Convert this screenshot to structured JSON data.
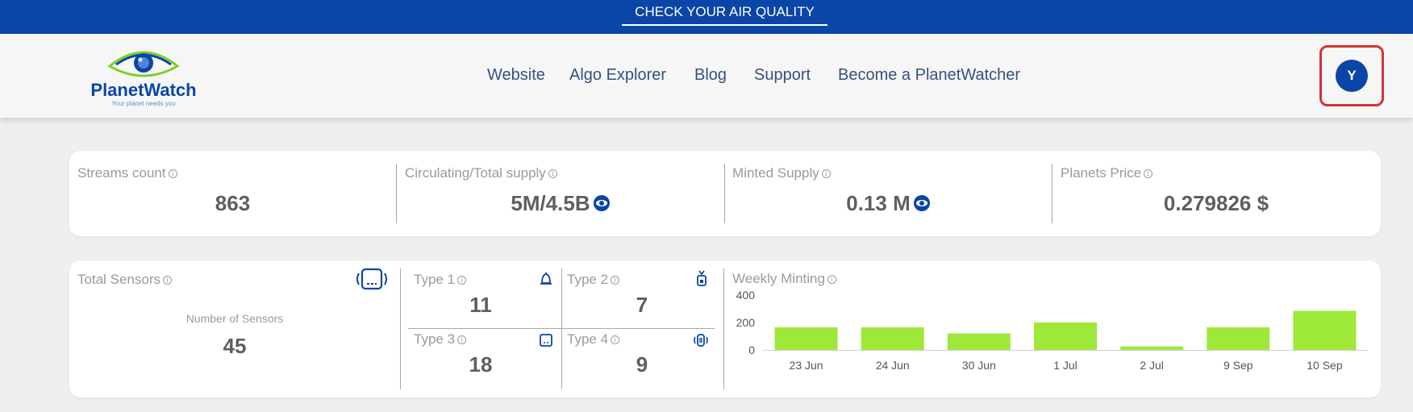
{
  "topbar": {
    "cta": "CHECK YOUR AIR QUALITY"
  },
  "logo": {
    "brand": "PlanetWatch",
    "tagline": "Your planet needs you"
  },
  "nav": [
    "Website",
    "Algo Explorer",
    "Blog",
    "Support",
    "Become a PlanetWatcher"
  ],
  "user": {
    "initial": "Y"
  },
  "stats": [
    {
      "label": "Streams count",
      "value": "863"
    },
    {
      "label": "Circulating/Total supply",
      "value": "5M/4.5B"
    },
    {
      "label": "Minted Supply",
      "value": "0.13 M"
    },
    {
      "label": "Planets Price",
      "value": "0.279826 $"
    }
  ],
  "sensors": {
    "title": "Total Sensors",
    "sublabel": "Number of Sensors",
    "count": "45",
    "types": [
      {
        "label": "Type 1",
        "count": "11",
        "icon": "bell-sensor-icon"
      },
      {
        "label": "Type 2",
        "count": "7",
        "icon": "lantern-sensor-icon"
      },
      {
        "label": "Type 3",
        "count": "18",
        "icon": "box-sensor-icon"
      },
      {
        "label": "Type 4",
        "count": "9",
        "icon": "wireless-sensor-icon"
      }
    ]
  },
  "colors": {
    "brand": "#0a45a8",
    "bar": "#9ee83a",
    "highlight": "#d2333a"
  },
  "chart_data": {
    "type": "bar",
    "title": "Weekly Minting",
    "categories": [
      "23 Jun",
      "24 Jun",
      "30 Jun",
      "1 Jul",
      "2 Jul",
      "9 Sep",
      "10 Sep"
    ],
    "values": [
      165,
      165,
      120,
      200,
      25,
      165,
      285
    ],
    "ylim": [
      0,
      400
    ],
    "yticks": [
      "0",
      "200",
      "400"
    ],
    "grid": false
  }
}
